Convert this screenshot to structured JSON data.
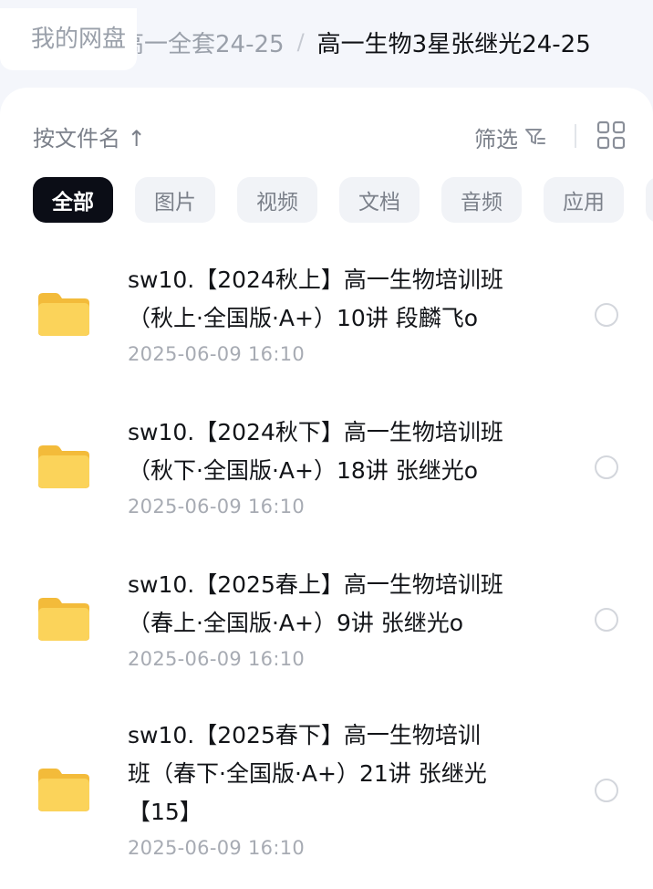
{
  "breadcrumb": {
    "root": "我的网盘",
    "parent": "高一全套24-25",
    "separator": "/",
    "current": "高一生物3星张继光24-25"
  },
  "toolbar": {
    "sort_label": "按文件名 ↑",
    "filter_label": "筛选",
    "filter_icon": "filter-icon",
    "view_icon": "grid-view-icon"
  },
  "chips": [
    {
      "label": "全部",
      "active": true
    },
    {
      "label": "图片",
      "active": false
    },
    {
      "label": "视频",
      "active": false
    },
    {
      "label": "文档",
      "active": false
    },
    {
      "label": "音频",
      "active": false
    },
    {
      "label": "应用",
      "active": false
    }
  ],
  "files": [
    {
      "name_line1": "sw10.【2024秋上】高一生物培训班",
      "name_line2": "（秋上·全国版·A+）10讲 段麟飞o",
      "name_line3": "",
      "date": "2025-06-09  16:10",
      "icon": "folder-icon"
    },
    {
      "name_line1": "sw10.【2024秋下】高一生物培训班",
      "name_line2": "（秋下·全国版·A+）18讲 张继光o",
      "name_line3": "",
      "date": "2025-06-09  16:10",
      "icon": "folder-icon"
    },
    {
      "name_line1": "sw10.【2025春上】高一生物培训班",
      "name_line2": "（春上·全国版·A+）9讲 张继光o",
      "name_line3": "",
      "date": "2025-06-09  16:10",
      "icon": "folder-icon"
    },
    {
      "name_line1": "sw10.【2025春下】高一生物培训",
      "name_line2": "班（春下·全国版·A+）21讲 张继光",
      "name_line3": "【15】",
      "date": "2025-06-09  16:10",
      "icon": "folder-icon"
    }
  ],
  "colors": {
    "folder": "#f7c948",
    "active_chip": "#0b0d16",
    "muted_text": "#7b808a"
  }
}
